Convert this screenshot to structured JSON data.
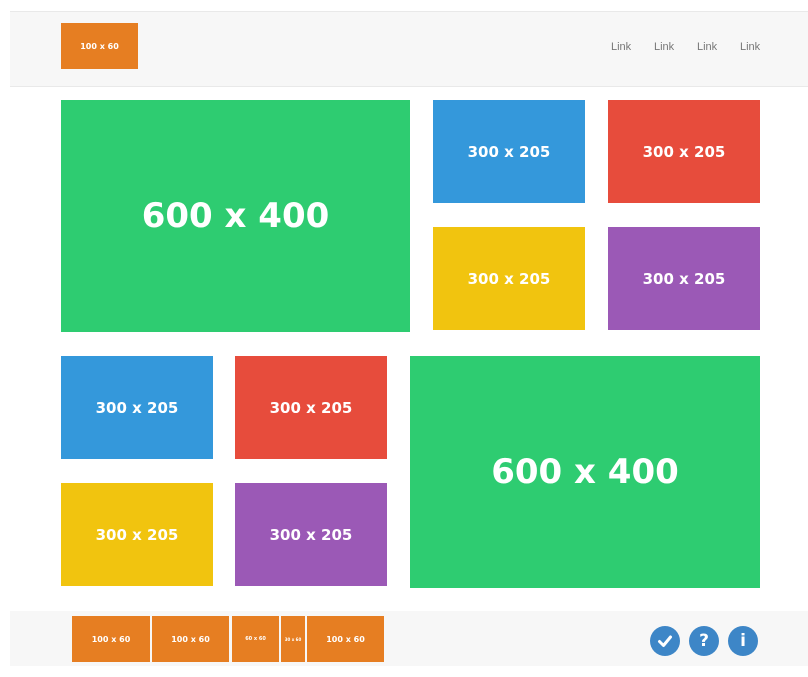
{
  "header": {
    "logo_label": "100 x 60",
    "links": [
      "Link",
      "Link",
      "Link",
      "Link"
    ]
  },
  "grid": {
    "top_large_label": "600 x 400",
    "top_small_labels": [
      "300 x 205",
      "300 x 205",
      "300 x 205",
      "300 x 205"
    ],
    "bottom_small_labels": [
      "300 x 205",
      "300 x 205",
      "300 x 205",
      "300 x 205"
    ],
    "bottom_large_label": "600 x 400"
  },
  "footer": {
    "thumb_labels": [
      "100 x 60",
      "100 x 60",
      "60 x 60",
      "30 x 60",
      "100 x 60"
    ],
    "icons": [
      "check-icon",
      "question-icon",
      "info-icon"
    ]
  },
  "colors": {
    "orange": "#e67e22",
    "green": "#2ecc71",
    "blue": "#3498db",
    "red": "#e74c3c",
    "yellow": "#f1c40f",
    "purple": "#9b59b6",
    "icon_blue": "#3d86c7"
  }
}
